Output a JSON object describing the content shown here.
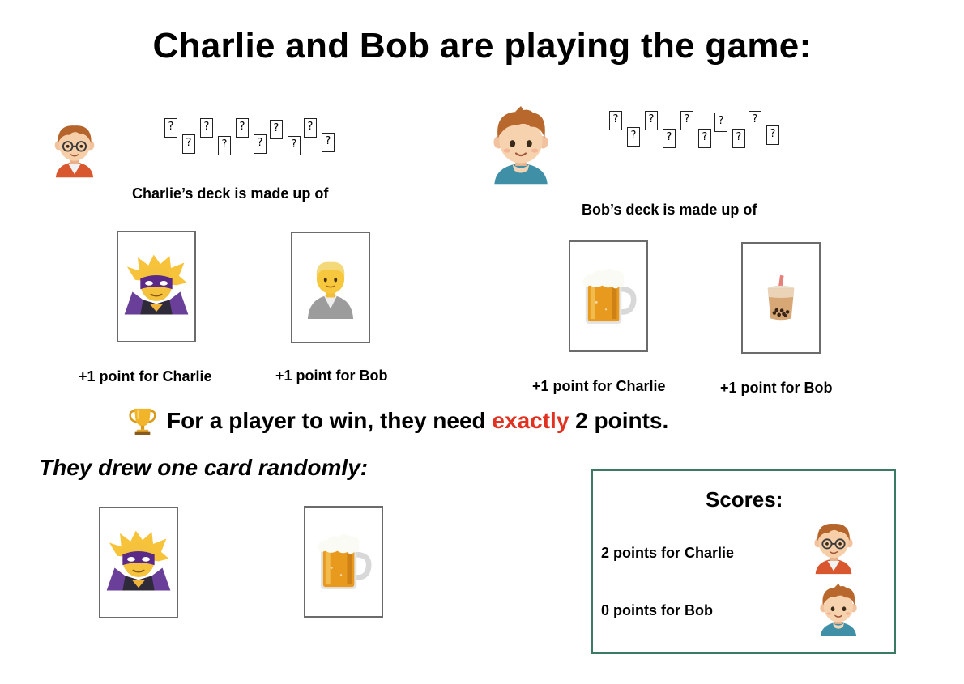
{
  "title": "Charlie and Bob are playing the game:",
  "charlie": {
    "deck_label": "Charlie’s deck is made up of",
    "cards": [
      {
        "icon": "supervillain-icon",
        "label": "+1 point for Charlie"
      },
      {
        "icon": "person-icon",
        "label": "+1 point for Bob"
      }
    ]
  },
  "bob": {
    "deck_label": "Bob’s deck is made up of",
    "cards": [
      {
        "icon": "beer-mug-icon",
        "label": "+1 point for Charlie"
      },
      {
        "icon": "bubble-tea-icon",
        "label": "+1 point for Bob"
      }
    ]
  },
  "mini_card_glyph": "?",
  "rule": {
    "icon": "trophy-icon",
    "prefix": "For a player to win, they need ",
    "emphasis": "exactly",
    "suffix": " 2 points."
  },
  "drew_label": "They drew one card randomly:",
  "drawn_cards": [
    {
      "icon": "supervillain-icon"
    },
    {
      "icon": "beer-mug-icon"
    }
  ],
  "scores": {
    "title": "Scores:",
    "lines": [
      {
        "text": "2 points for Charlie",
        "avatar": "charlie-avatar"
      },
      {
        "text": "0 points for Bob",
        "avatar": "bob-avatar"
      }
    ]
  },
  "colors": {
    "emphasis": "#e03121",
    "scores_border": "#3d7a66",
    "card_border": "#6b6b6b"
  }
}
